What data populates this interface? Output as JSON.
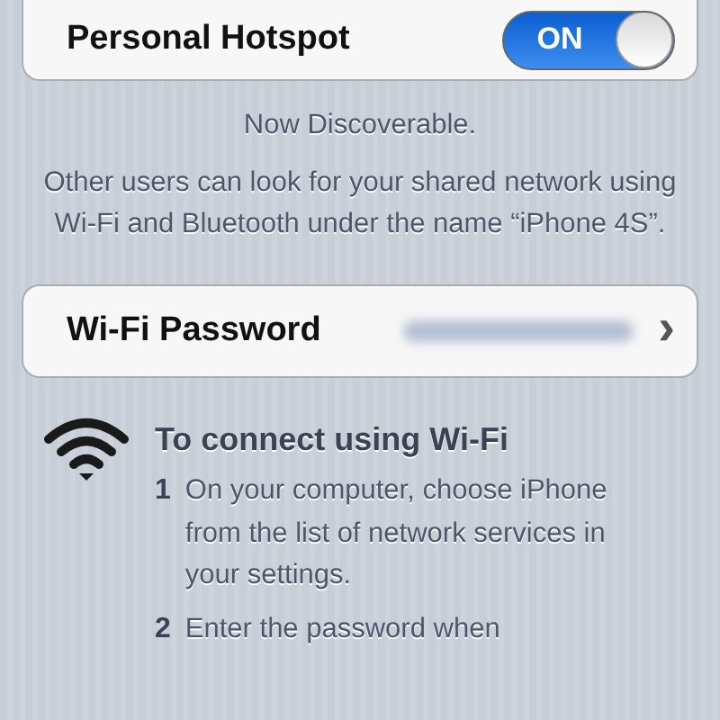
{
  "hotspot": {
    "label": "Personal Hotspot",
    "on": true,
    "state_text": "ON"
  },
  "status": "Now Discoverable.",
  "description": "Other users can look for your shared network using Wi-Fi and Bluetooth under the name “iPhone 4S”.",
  "wifi_password": {
    "label": "Wi-Fi Password",
    "chevron": "›"
  },
  "instructions": {
    "title": "To connect using Wi-Fi",
    "steps": [
      {
        "number": "1",
        "text": "On your computer, choose iPhone from the list of network services in your settings."
      },
      {
        "number": "2",
        "text": "Enter the password when"
      }
    ]
  }
}
